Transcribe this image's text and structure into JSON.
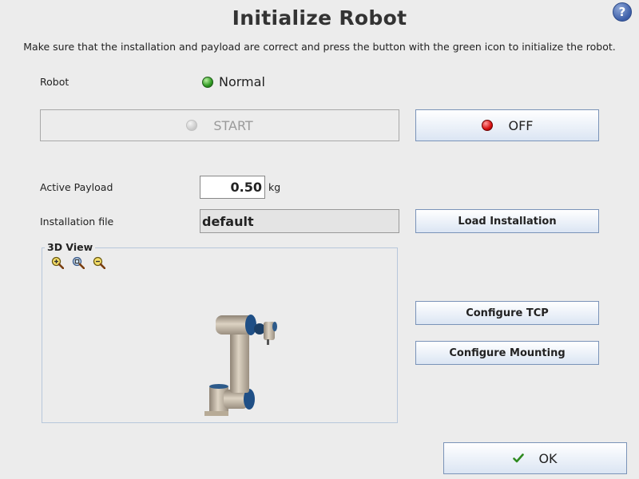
{
  "header": {
    "title": "Initialize Robot",
    "help_label": "?",
    "instructions": "Make sure that the installation and payload are correct and press the button with the green icon to initialize the robot."
  },
  "robot": {
    "label": "Robot",
    "status": "Normal",
    "status_color": "#2f9a22"
  },
  "power": {
    "start_label": "START",
    "off_label": "OFF",
    "off_color": "#d81010"
  },
  "payload": {
    "label": "Active Payload",
    "value": "0.50",
    "unit": "kg"
  },
  "installation": {
    "label": "Installation file",
    "value": "default",
    "load_label": "Load Installation"
  },
  "view3d": {
    "title": "3D View",
    "zoom_in_icon": "zoom-in-icon",
    "zoom_reset_icon": "zoom-reset-icon",
    "zoom_out_icon": "zoom-out-icon"
  },
  "actions": {
    "configure_tcp_label": "Configure TCP",
    "configure_mounting_label": "Configure Mounting",
    "ok_label": "OK"
  }
}
